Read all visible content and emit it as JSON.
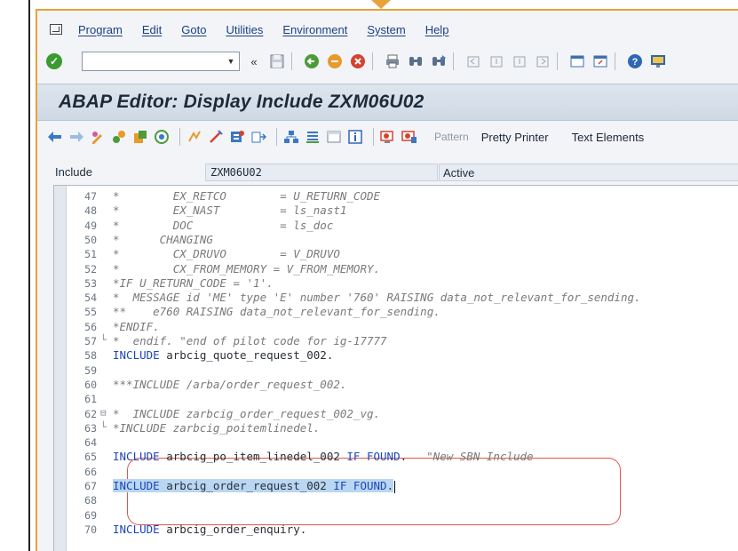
{
  "menu": {
    "items": [
      "Program",
      "Edit",
      "Goto",
      "Utilities",
      "Environment",
      "System",
      "Help"
    ]
  },
  "toolbar": {
    "command_field_value": "",
    "back_glyph": "«"
  },
  "title": "ABAP Editor: Display Include ZXM06U02",
  "app_toolbar": {
    "pattern_label": "Pattern",
    "pretty_printer_label": "Pretty Printer",
    "text_elements_label": "Text Elements"
  },
  "include": {
    "label": "Include",
    "name": "ZXM06U02",
    "status": "Active"
  },
  "code_lines": [
    {
      "n": "47",
      "text": "*        EX_RETCO        = U_RETURN_CODE",
      "type": "comment",
      "fold": ""
    },
    {
      "n": "48",
      "text": "*        EX_NAST         = ls_nast1",
      "type": "comment",
      "fold": ""
    },
    {
      "n": "49",
      "text": "*        DOC             = ls_doc",
      "type": "comment",
      "fold": ""
    },
    {
      "n": "50",
      "text": "*      CHANGING",
      "type": "comment",
      "fold": ""
    },
    {
      "n": "51",
      "text": "*        CX_DRUVO        = V_DRUVO",
      "type": "comment",
      "fold": ""
    },
    {
      "n": "52",
      "text": "*        CX_FROM_MEMORY = V_FROM_MEMORY.",
      "type": "comment",
      "fold": ""
    },
    {
      "n": "53",
      "text": "*IF U_RETURN_CODE = '1'.",
      "type": "comment",
      "fold": ""
    },
    {
      "n": "54",
      "text": "*  MESSAGE id 'ME' type 'E' number '760' RAISING data_not_relevant_for_sending.",
      "type": "comment",
      "fold": ""
    },
    {
      "n": "55",
      "text": "**    e760 RAISING data_not_relevant_for_sending.",
      "type": "comment",
      "fold": ""
    },
    {
      "n": "56",
      "text": "*ENDIF.",
      "type": "comment",
      "fold": ""
    },
    {
      "n": "57",
      "text": "*  endif. \"end of pilot code for ig-17777",
      "type": "comment",
      "fold": "└"
    },
    {
      "n": "58",
      "text": "INCLUDE arbcig_quote_request_002.",
      "type": "include",
      "fold": ""
    },
    {
      "n": "59",
      "text": "",
      "type": "blank",
      "fold": ""
    },
    {
      "n": "60",
      "text": "***INCLUDE /arba/order_request_002.",
      "type": "comment",
      "fold": ""
    },
    {
      "n": "61",
      "text": "",
      "type": "blank",
      "fold": ""
    },
    {
      "n": "62",
      "text": "*  INCLUDE zarbcig_order_request_002_vg.",
      "type": "comment",
      "fold": "⊟"
    },
    {
      "n": "63",
      "text": "*INCLUDE zarbcig_poitemlinedel.",
      "type": "comment",
      "fold": "└"
    },
    {
      "n": "64",
      "text": "",
      "type": "blank",
      "fold": ""
    },
    {
      "n": "65",
      "text": "INCLUDE arbcig_po_item_linedel_002 IF FOUND.",
      "comment": "\"New SBN Include",
      "type": "include_found",
      "fold": ""
    },
    {
      "n": "66",
      "text": "",
      "type": "blank",
      "fold": ""
    },
    {
      "n": "67",
      "text": "INCLUDE arbcig_order_request_002 IF FOUND.",
      "type": "include_selected",
      "fold": ""
    },
    {
      "n": "68",
      "text": "",
      "type": "blank",
      "fold": ""
    },
    {
      "n": "69",
      "text": "",
      "type": "blank",
      "fold": ""
    },
    {
      "n": "70",
      "text": "INCLUDE arbcig_order_enquiry.",
      "type": "include",
      "fold": ""
    }
  ]
}
